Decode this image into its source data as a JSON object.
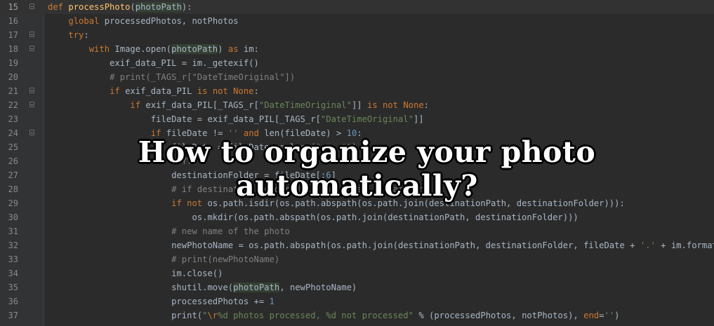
{
  "editor": {
    "colors": {
      "background": "#2b2b2b",
      "keyword": "#cc7832",
      "function": "#ffc66d",
      "string": "#6a8759",
      "comment": "#808080",
      "number": "#6897bb",
      "text": "#a9b7c6"
    },
    "lines": [
      {
        "no": "15",
        "tokens": [
          [
            "kw",
            "def "
          ],
          [
            "fn",
            "processPhoto"
          ],
          [
            "",
            "("
          ],
          [
            "hl",
            "photoPath"
          ],
          [
            "",
            "):"
          ]
        ]
      },
      {
        "no": "16",
        "tokens": [
          [
            "",
            "    "
          ],
          [
            "kw",
            "global "
          ],
          [
            "",
            "processedPhotos, notPhotos"
          ]
        ]
      },
      {
        "no": "17",
        "tokens": [
          [
            "",
            "    "
          ],
          [
            "kw",
            "try"
          ],
          [
            "",
            ":"
          ]
        ]
      },
      {
        "no": "18",
        "tokens": [
          [
            "",
            "        "
          ],
          [
            "kw",
            "with "
          ],
          [
            "",
            "Image.open("
          ],
          [
            "hl",
            "photoPath"
          ],
          [
            "",
            ") "
          ],
          [
            "kw",
            "as "
          ],
          [
            "",
            "im:"
          ]
        ]
      },
      {
        "no": "19",
        "tokens": [
          [
            "",
            "            exif_data_PIL = im._getexif()"
          ]
        ]
      },
      {
        "no": "20",
        "tokens": [
          [
            "",
            "            "
          ],
          [
            "com",
            "# print(_TAGS_r[\"DateTimeOriginal\"])"
          ]
        ]
      },
      {
        "no": "21",
        "tokens": [
          [
            "",
            "            "
          ],
          [
            "kw",
            "if "
          ],
          [
            "",
            "exif_data_PIL "
          ],
          [
            "kw",
            "is not None"
          ],
          [
            "",
            ":"
          ]
        ]
      },
      {
        "no": "22",
        "tokens": [
          [
            "",
            "                "
          ],
          [
            "kw",
            "if "
          ],
          [
            "",
            "exif_data_PIL[_TAGS_r["
          ],
          [
            "str",
            "\"DateTimeOriginal\""
          ],
          [
            "",
            "]] "
          ],
          [
            "kw",
            "is not None"
          ],
          [
            "",
            ":"
          ]
        ]
      },
      {
        "no": "23",
        "tokens": [
          [
            "",
            "                    fileDate = exif_data_PIL[_TAGS_r["
          ],
          [
            "str",
            "\"DateTimeOriginal\""
          ],
          [
            "",
            "]]"
          ]
        ]
      },
      {
        "no": "24",
        "tokens": [
          [
            "",
            "                    "
          ],
          [
            "kw",
            "if "
          ],
          [
            "",
            "fileDate != "
          ],
          [
            "str",
            "''"
          ],
          [
            "kw",
            " and "
          ],
          [
            "",
            "len(fileDate) > "
          ],
          [
            "num",
            "10"
          ],
          [
            "",
            ":"
          ]
        ]
      },
      {
        "no": "25",
        "tokens": [
          [
            "",
            "                        fileDate = fileDate.replace("
          ],
          [
            "str",
            "\":\""
          ],
          [
            "",
            ", "
          ],
          [
            "str",
            "\"\""
          ],
          [
            "",
            ")"
          ]
        ]
      },
      {
        "no": "26",
        "tokens": [
          [
            "",
            "                        "
          ],
          [
            "com",
            "# YYY"
          ]
        ]
      },
      {
        "no": "27",
        "tokens": [
          [
            "",
            "                        destinationFolder = fileDate[:"
          ],
          [
            "num",
            "6"
          ],
          [
            "",
            "]"
          ]
        ]
      },
      {
        "no": "28",
        "tokens": [
          [
            "",
            "                        "
          ],
          [
            "com",
            "# if destination folder does not exist, create one"
          ]
        ]
      },
      {
        "no": "29",
        "tokens": [
          [
            "",
            "                        "
          ],
          [
            "kw",
            "if not "
          ],
          [
            "",
            "os.path.isdir(os.path.abspath(os.path.join(destinationPath, destinationFolder))):"
          ]
        ]
      },
      {
        "no": "30",
        "tokens": [
          [
            "",
            "                            os.mkdir(os.path.abspath(os.path.join(destinationPath, destinationFolder)))"
          ]
        ]
      },
      {
        "no": "31",
        "tokens": [
          [
            "",
            "                        "
          ],
          [
            "com",
            "# new name of the photo"
          ]
        ]
      },
      {
        "no": "32",
        "tokens": [
          [
            "",
            "                        newPhotoName = os.path.abspath(os.path.join(destinationPath, destinationFolder, fileDate + "
          ],
          [
            "str",
            "'.'"
          ],
          [
            "",
            " + im.format))"
          ]
        ]
      },
      {
        "no": "33",
        "tokens": [
          [
            "",
            "                        "
          ],
          [
            "com",
            "# print(newPhotoName)"
          ]
        ]
      },
      {
        "no": "34",
        "tokens": [
          [
            "",
            "                        im.close()"
          ]
        ]
      },
      {
        "no": "35",
        "tokens": [
          [
            "",
            "                        shutil.move("
          ],
          [
            "hl",
            "photoPath"
          ],
          [
            "",
            ", newPhotoName)"
          ]
        ]
      },
      {
        "no": "36",
        "tokens": [
          [
            "",
            "                        processedPhotos += "
          ],
          [
            "num",
            "1"
          ]
        ]
      },
      {
        "no": "37",
        "tokens": [
          [
            "",
            "                        print("
          ],
          [
            "str",
            "\""
          ],
          [
            "esc",
            "\\r"
          ],
          [
            "str",
            "%d photos processed, %d not processed\""
          ],
          [
            "",
            " % (processedPhotos, notPhotos), "
          ],
          [
            "kw",
            "end"
          ],
          [
            "",
            "="
          ],
          [
            "str",
            "''"
          ],
          [
            "",
            ")"
          ]
        ]
      }
    ]
  },
  "overlay": {
    "title": "How to organize your photo automatically?"
  }
}
